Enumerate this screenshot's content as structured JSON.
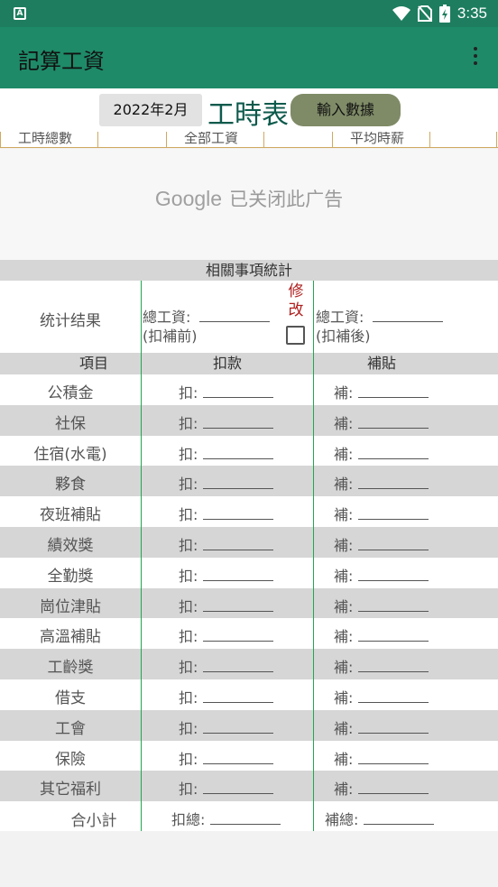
{
  "status_bar": {
    "time": "3:35",
    "app_icon": "A"
  },
  "app_bar": {
    "title": "記算工資"
  },
  "header": {
    "month": "2022年2月",
    "title": "工時表",
    "input_button": "輸入數據"
  },
  "summary": {
    "hours_total": "工時總數",
    "total_wage": "全部工資",
    "avg_wage": "平均時薪"
  },
  "ad": {
    "brand": "Google",
    "text": "已关闭此广告"
  },
  "stats": {
    "section_title": "相關事項統計",
    "result_label": "统计结果",
    "total_wage_before": "總工資:",
    "before_note": "(扣補前)",
    "modify": "修改",
    "total_wage_after": "總工資:",
    "after_note": "(扣補後)"
  },
  "columns": {
    "item": "項目",
    "deduct": "扣款",
    "subsidy": "補貼"
  },
  "deduct_prefix": "扣:",
  "subsidy_prefix": "補:",
  "items": [
    {
      "name": "公積金"
    },
    {
      "name": "社保"
    },
    {
      "name": "住宿(水電)"
    },
    {
      "name": "夥食"
    },
    {
      "name": "夜班補貼"
    },
    {
      "name": "績效獎"
    },
    {
      "name": "全勤獎"
    },
    {
      "name": "崗位津貼"
    },
    {
      "name": "高溫補貼"
    },
    {
      "name": "工齡獎"
    },
    {
      "name": "借支"
    },
    {
      "name": "工會"
    },
    {
      "name": "保險"
    },
    {
      "name": "其它福利"
    }
  ],
  "totals": {
    "label": "合小計",
    "deduct_total": "扣總:",
    "subsidy_total": "補總:"
  }
}
